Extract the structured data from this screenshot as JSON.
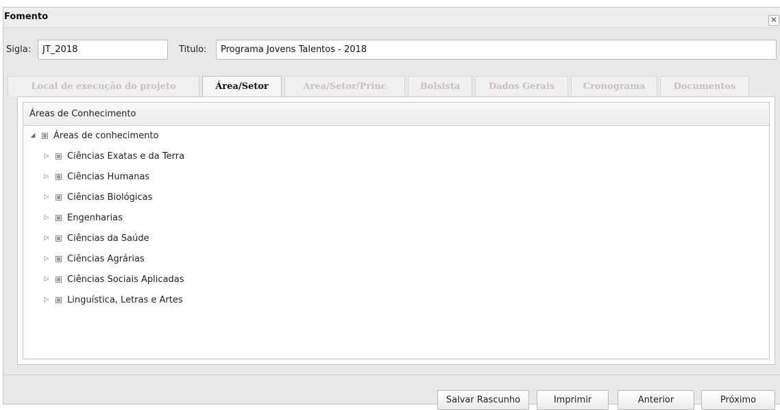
{
  "window": {
    "title": "Fomento",
    "close_glyph": "✕"
  },
  "form": {
    "sigla_label": "Sigla:",
    "sigla_value": "JT_2018",
    "titulo_label": "Titulo:",
    "titulo_value": "Programa Jovens Talentos - 2018"
  },
  "tabs": [
    {
      "label": "Local de execução do projeto",
      "active": false
    },
    {
      "label": "Área/Setor",
      "active": true
    },
    {
      "label": "Area/Setor/Princ",
      "active": false
    },
    {
      "label": "Bolsista",
      "active": false
    },
    {
      "label": "Dados Gerais",
      "active": false
    },
    {
      "label": "Cronograma",
      "active": false
    },
    {
      "label": "Documentos",
      "active": false
    }
  ],
  "tree": {
    "header": "Áreas de Conhecimento",
    "root": {
      "label": "Áreas de conhecimento",
      "expanded": true,
      "arrow": "◢"
    },
    "children": [
      {
        "label": "Ciências Exatas e da Terra",
        "arrow": "▷"
      },
      {
        "label": "Ciências Humanas",
        "arrow": "▷"
      },
      {
        "label": "Ciências Biológicas",
        "arrow": "▷"
      },
      {
        "label": "Engenharias",
        "arrow": "▷"
      },
      {
        "label": "Ciências da Saúde",
        "arrow": "▷"
      },
      {
        "label": "Ciências Agrárias",
        "arrow": "▷"
      },
      {
        "label": "Ciências Sociais Aplicadas",
        "arrow": "▷"
      },
      {
        "label": "Linguística, Letras e Artes",
        "arrow": "▷"
      }
    ]
  },
  "buttons": {
    "salvar": "Salvar Rascunho",
    "imprimir": "Imprimir",
    "anterior": "Anterior",
    "proximo": "Próximo"
  },
  "icons": {
    "close": "close-icon",
    "expand": "expand-arrow-icon",
    "collapse": "collapse-arrow-icon",
    "node": "tree-node-icon"
  },
  "colors": {
    "active_tab_text": "#111111",
    "inactive_tab_text": "#c8c0c0",
    "dialog_bg": "#e8e8e8"
  }
}
